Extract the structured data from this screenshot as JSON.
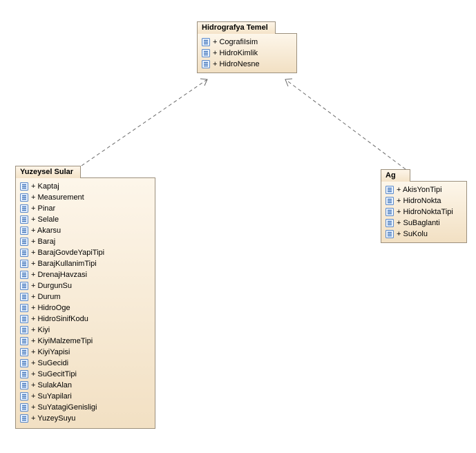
{
  "packages": {
    "top": {
      "title": "Hidrografya Temel",
      "items": [
        "+ CografiIsim",
        "+ HidroKimlik",
        "+ HidroNesne"
      ]
    },
    "left": {
      "title": "Yuzeysel Sular",
      "items": [
        "+ Kaptaj",
        "+ Measurement",
        "+ Pinar",
        "+ Selale",
        "+ Akarsu",
        "+ Baraj",
        "+ BarajGovdeYapiTipi",
        "+ BarajKullanimTipi",
        "+ DrenajHavzasi",
        "+ DurgunSu",
        "+ Durum",
        "+ HidroOge",
        "+ HidroSinifKodu",
        "+ Kiyi",
        "+ KiyiMalzemeTipi",
        "+ KiyiYapisi",
        "+ SuGecidi",
        "+ SuGecitTipi",
        "+ SulakAlan",
        "+ SuYapilari",
        "+ SuYatagiGenisligi",
        "+ YuzeySuyu"
      ]
    },
    "right": {
      "title": "Ag",
      "items": [
        "+ AkisYonTipi",
        "+ HidroNokta",
        "+ HidroNoktaTipi",
        "+ SuBaglanti",
        "+ SuKolu"
      ]
    }
  },
  "icon_name": "class-icon"
}
